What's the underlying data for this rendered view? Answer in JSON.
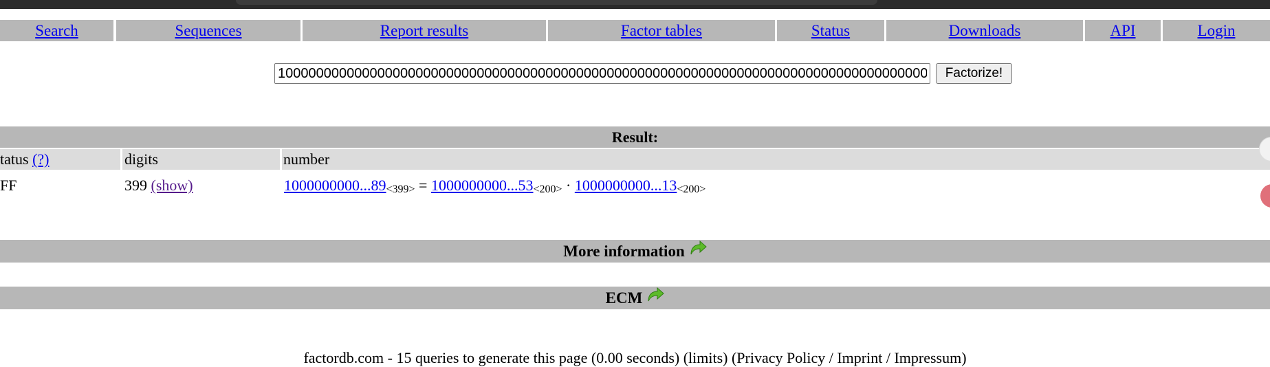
{
  "nav": {
    "items": [
      {
        "label": "Search"
      },
      {
        "label": "Sequences"
      },
      {
        "label": "Report results"
      },
      {
        "label": "Factor tables"
      },
      {
        "label": "Status"
      },
      {
        "label": "Downloads"
      },
      {
        "label": "API"
      },
      {
        "label": "Login"
      }
    ]
  },
  "search": {
    "value": "10000000000000000000000000000000000000000000000000000000000000000000000000000000000000000",
    "button_label": "Factorize!"
  },
  "result": {
    "title": "Result:",
    "columns": {
      "status": "tatus",
      "status_help": "(?)",
      "digits": "digits",
      "number": "number"
    },
    "row": {
      "status": "FF",
      "digits": "399",
      "show_link": "(show)",
      "number_link": "1000000000...89",
      "number_sub": "<399>",
      "equals": "=",
      "factor1_link": "1000000000...53",
      "factor1_sub": "<200>",
      "times": "·",
      "factor2_link": "1000000000...13",
      "factor2_sub": "<200>"
    }
  },
  "more_info": {
    "label": "More information"
  },
  "ecm": {
    "label": "ECM"
  },
  "footer": {
    "text": "factordb.com - 15 queries to generate this page (0.00 seconds) (limits) (Privacy Policy / Imprint / Impressum)"
  },
  "colors": {
    "bar_gray": "#b7b7b7",
    "header_gray": "#dcdcdc",
    "link_blue": "#0000ee",
    "visited_purple": "#551a8b",
    "arrow_green": "#5dbb2a"
  }
}
